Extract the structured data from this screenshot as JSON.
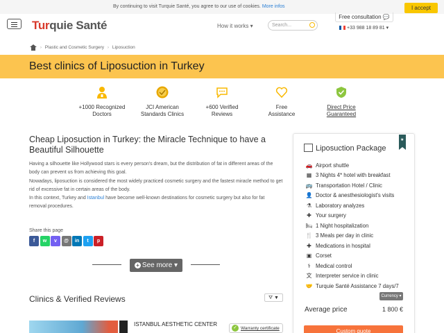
{
  "cookie": {
    "text": "By continuing to visit Turquie Santé, you agree to our use of cookies.",
    "more_link": "More infos",
    "accept": "I accept"
  },
  "header": {
    "logo_part1": "Tur",
    "logo_part2": "quie Santé",
    "nav_how": "How it works",
    "search_placeholder": "Search...",
    "consult": "Free consultation",
    "phone": "+33 988 18 89 81"
  },
  "breadcrumb": {
    "items": [
      "Plastic and Cosmetic Surgery",
      "Liposuction"
    ]
  },
  "page_title": "Best clinics of Liposuction in Turkey",
  "features": [
    {
      "line1": "+1000 Recognized",
      "line2": "Doctors",
      "icon": "doctor-icon",
      "color": "#f9b800"
    },
    {
      "line1": "JCI American",
      "line2": "Standards Clinics",
      "icon": "jci-badge-icon",
      "color": "#e8a800"
    },
    {
      "line1": "+600 Verified",
      "line2": "Reviews",
      "icon": "chat-icon",
      "color": "#f9b800"
    },
    {
      "line1": "Free",
      "line2": "Assistance",
      "icon": "heart-icon",
      "color": "#f9b800"
    },
    {
      "line1": "Direct Price",
      "line2": "Guaranteed",
      "icon": "check-shield-icon",
      "color": "#8dc63f"
    }
  ],
  "article": {
    "title": "Cheap Liposuction in Turkey: the Miracle Technique to have a Beautiful Silhouette",
    "p1": "Having a silhouette like Hollywood stars is every person's dream, but the distribution of fat in different areas of the body can prevent us from achieving this goal.",
    "p2": "Nowadays, liposuction is considered the most widely practiced cosmetic surgery and the fastest miracle method to get rid of excessive fat in certain areas of the body.",
    "p3_a": "In this context, Turkey and ",
    "p3_link": "Istanbul",
    "p3_b": " have become well-known destinations for cosmetic surgery but also for fat removal procedures.",
    "share_label": "Share this page",
    "see_more": "See more"
  },
  "social": [
    {
      "name": "facebook-icon",
      "glyph": "f",
      "color": "#3b5998"
    },
    {
      "name": "whatsapp-icon",
      "glyph": "w",
      "color": "#25d366"
    },
    {
      "name": "viber-icon",
      "glyph": "v",
      "color": "#7360f2"
    },
    {
      "name": "email-icon",
      "glyph": "@",
      "color": "#777777"
    },
    {
      "name": "linkedin-icon",
      "glyph": "in",
      "color": "#0077b5"
    },
    {
      "name": "twitter-icon",
      "glyph": "t",
      "color": "#1da1f2"
    },
    {
      "name": "pinterest-icon",
      "glyph": "p",
      "color": "#cb2027"
    }
  ],
  "reviews": {
    "title": "Clinics & Verified Reviews",
    "filter": "▼",
    "clinic_name": "ISTANBUL AESTHETIC CENTER",
    "warranty": "Warranty certificate"
  },
  "package": {
    "title": "Liposuction Package",
    "items": [
      {
        "icon": "car-icon",
        "glyph": "🚗",
        "label": "Airport shuttle"
      },
      {
        "icon": "hotel-icon",
        "glyph": "▦",
        "label": "3 Nights 4* hotel with breakfast"
      },
      {
        "icon": "bus-icon",
        "glyph": "🚌",
        "label": "Transportation Hotel / Clinic"
      },
      {
        "icon": "doctor-icon",
        "glyph": "👤",
        "label": "Doctor & anesthesiologist's visits"
      },
      {
        "icon": "flask-icon",
        "glyph": "⚗",
        "label": "Laboratory analyzes"
      },
      {
        "icon": "surgery-icon",
        "glyph": "✚",
        "label": "Your surgery"
      },
      {
        "icon": "bed-icon",
        "glyph": "🛏",
        "label": "1 Night hospitalization"
      },
      {
        "icon": "meal-icon",
        "glyph": "🍴",
        "label": "3 Meals per day in clinic"
      },
      {
        "icon": "medication-icon",
        "glyph": "✚",
        "label": "Medications in hospital"
      },
      {
        "icon": "corset-icon",
        "glyph": "▣",
        "label": "Corset"
      },
      {
        "icon": "medical-icon",
        "glyph": "⚕",
        "label": "Medical control"
      },
      {
        "icon": "interpreter-icon",
        "glyph": "文",
        "label": "Interpreter service in clinic"
      },
      {
        "icon": "handshake-icon",
        "glyph": "🤝",
        "label": "Turquie Santé Assistance 7 days/7"
      }
    ],
    "currency": "Currency",
    "avg_label": "Average price",
    "price": "1 800 €",
    "quote": "Custom quote"
  }
}
